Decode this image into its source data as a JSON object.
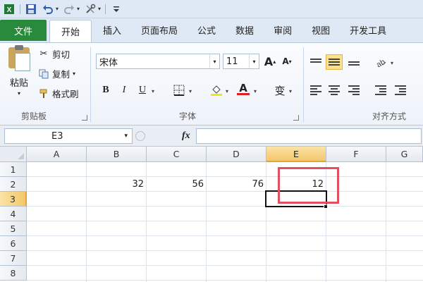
{
  "quick_access": {
    "icons": [
      "excel-logo-icon",
      "save-icon",
      "undo-icon",
      "redo-icon",
      "customize-icon"
    ]
  },
  "tabs": [
    "文件",
    "开始",
    "插入",
    "页面布局",
    "公式",
    "数据",
    "审阅",
    "视图",
    "开发工具"
  ],
  "ribbon": {
    "clipboard": {
      "paste": "粘贴",
      "cut": "剪切",
      "copy": "复制",
      "format_painter": "格式刷",
      "group_label": "剪贴板"
    },
    "font": {
      "font_name": "宋体",
      "font_size": "11",
      "bold": "B",
      "italic": "I",
      "underline": "U",
      "phonetic": "变",
      "grow": "A",
      "shrink": "A",
      "font_color_letter": "A",
      "group_label": "字体"
    },
    "alignment": {
      "group_label": "对齐方式"
    }
  },
  "formula_bar": {
    "name_box": "E3",
    "fx": "fx",
    "formula": ""
  },
  "sheet": {
    "columns": [
      "A",
      "B",
      "C",
      "D",
      "E",
      "F",
      "G"
    ],
    "rows": [
      "1",
      "2",
      "3",
      "4",
      "5",
      "6",
      "7",
      "8"
    ],
    "cells": {
      "B2": "32",
      "C2": "56",
      "D2": "76",
      "E2": "12"
    },
    "selected_cell": "E3"
  },
  "colors": {
    "file_tab": "#2a8a3c",
    "highlight": "#e05060",
    "selection_header": "#f3c76a"
  }
}
